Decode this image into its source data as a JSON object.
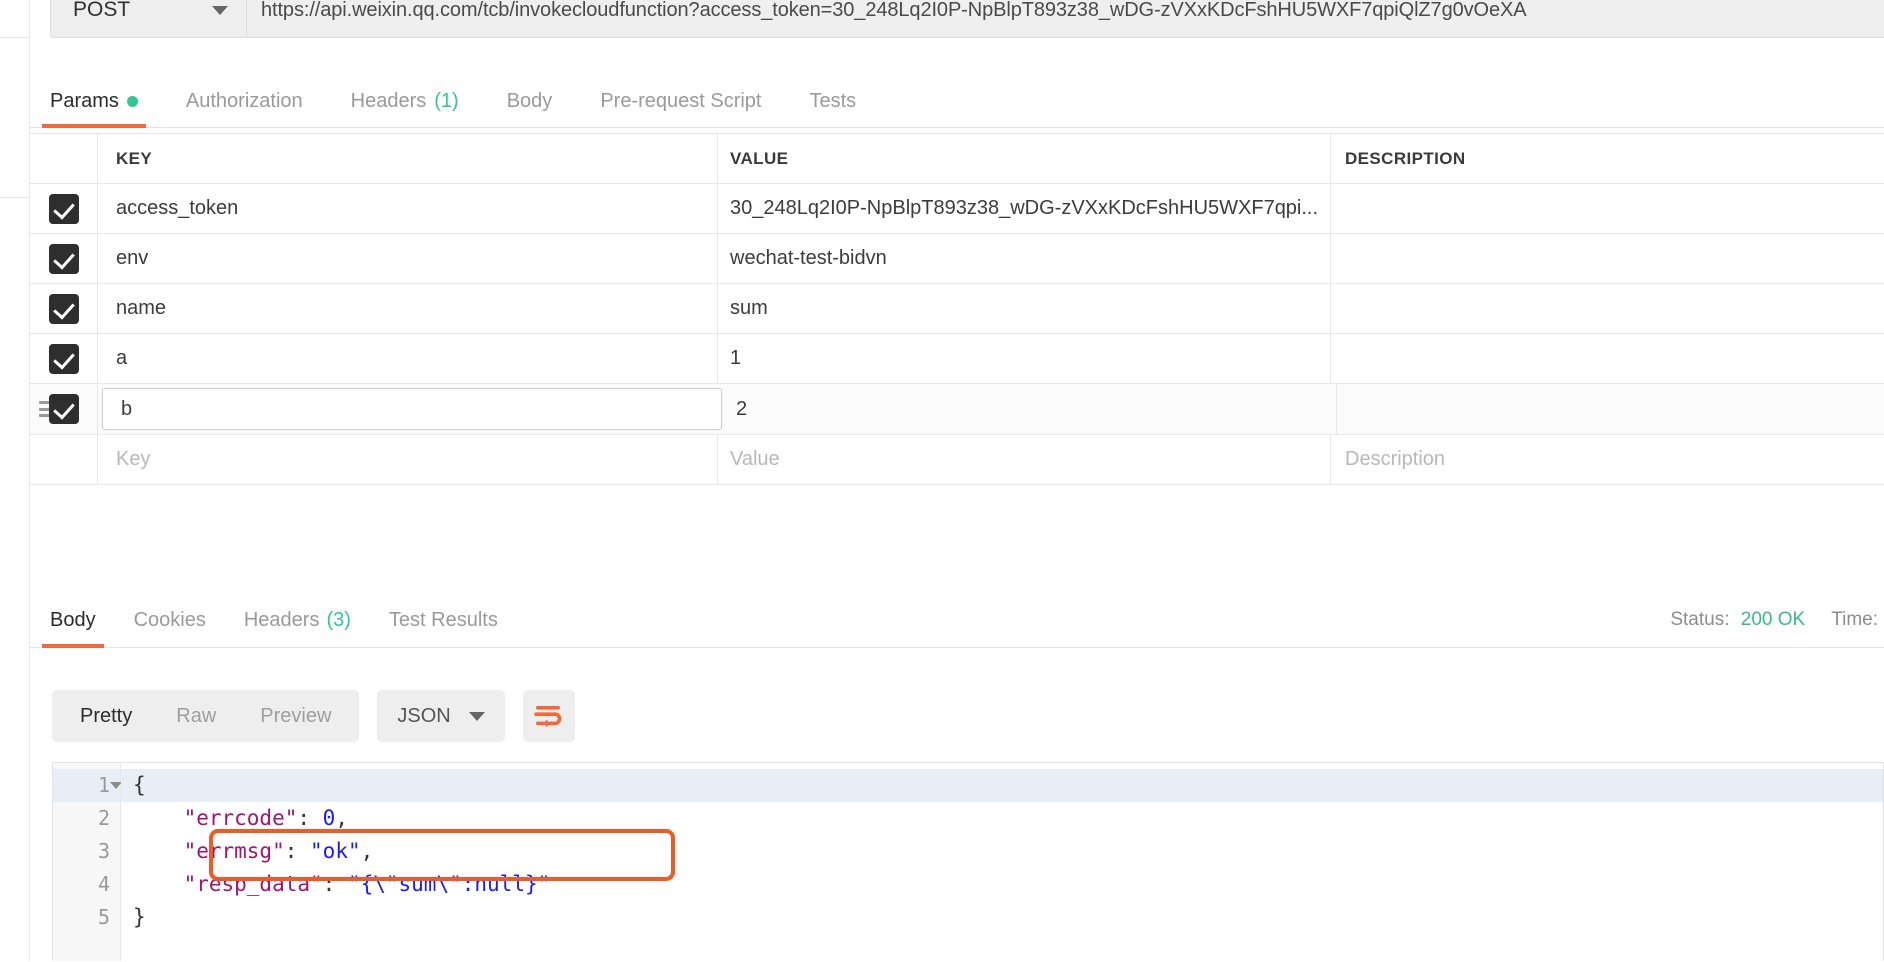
{
  "request": {
    "method": "POST",
    "method_caret_icon": "chevron-down-icon",
    "url": "https://api.weixin.qq.com/tcb/invokecloudfunction?access_token=30_248Lq2I0P-NpBlpT893z38_wDG-zVXxKDcFshHU5WXF7qpiQlZ7g0vOeXA",
    "tabs": [
      {
        "label": "Params",
        "badge": "",
        "dot": true,
        "active": true
      },
      {
        "label": "Authorization",
        "badge": "",
        "dot": false,
        "active": false
      },
      {
        "label": "Headers",
        "badge": "(1)",
        "dot": false,
        "active": false
      },
      {
        "label": "Body",
        "badge": "",
        "dot": false,
        "active": false
      },
      {
        "label": "Pre-request Script",
        "badge": "",
        "dot": false,
        "active": false
      },
      {
        "label": "Tests",
        "badge": "",
        "dot": false,
        "active": false
      }
    ]
  },
  "params_table": {
    "columns": [
      "KEY",
      "VALUE",
      "DESCRIPTION"
    ],
    "rows": [
      {
        "checked": true,
        "key": "access_token",
        "value": "30_248Lq2I0P-NpBlpT893z38_wDG-zVXxKDcFshHU5WXF7qpi...",
        "description": ""
      },
      {
        "checked": true,
        "key": "env",
        "value": "wechat-test-bidvn",
        "description": ""
      },
      {
        "checked": true,
        "key": "name",
        "value": "sum",
        "description": ""
      },
      {
        "checked": true,
        "key": "a",
        "value": "1",
        "description": ""
      },
      {
        "checked": true,
        "key": "b",
        "value": "2",
        "description": "",
        "editing": true,
        "drag_handle": true
      }
    ],
    "placeholder_row": {
      "key": "Key",
      "value": "Value",
      "description": "Description"
    }
  },
  "response": {
    "tabs": [
      {
        "label": "Body",
        "badge": "",
        "active": true
      },
      {
        "label": "Cookies",
        "badge": "",
        "active": false
      },
      {
        "label": "Headers",
        "badge": "(3)",
        "active": false
      },
      {
        "label": "Test Results",
        "badge": "",
        "active": false
      }
    ],
    "status_label": "Status:",
    "status_value": "200 OK",
    "time_label": "Time:",
    "toolbar": {
      "views": [
        {
          "label": "Pretty",
          "active": true
        },
        {
          "label": "Raw",
          "active": false
        },
        {
          "label": "Preview",
          "active": false
        }
      ],
      "format": "JSON",
      "format_caret_icon": "chevron-down-icon",
      "wrap_icon": "wrap-lines-icon"
    },
    "body": {
      "language": "json",
      "line_numbers": [
        "1",
        "2",
        "3",
        "4",
        "5"
      ],
      "lines": [
        {
          "text": "{",
          "segments": [
            {
              "t": "{",
              "c": "punc"
            }
          ]
        },
        {
          "text": "    \"errcode\": 0,",
          "segments": [
            {
              "t": "    ",
              "c": "punc"
            },
            {
              "t": "\"errcode\"",
              "c": "key"
            },
            {
              "t": ": ",
              "c": "punc"
            },
            {
              "t": "0",
              "c": "num"
            },
            {
              "t": ",",
              "c": "punc"
            }
          ]
        },
        {
          "text": "    \"errmsg\": \"ok\",",
          "segments": [
            {
              "t": "    ",
              "c": "punc"
            },
            {
              "t": "\"errmsg\"",
              "c": "key"
            },
            {
              "t": ": ",
              "c": "punc"
            },
            {
              "t": "\"ok\"",
              "c": "str"
            },
            {
              "t": ",",
              "c": "punc"
            }
          ]
        },
        {
          "text": "    \"resp_data\": \"{\\\"sum\\\":null}\"",
          "segments": [
            {
              "t": "    ",
              "c": "punc"
            },
            {
              "t": "\"resp_data\"",
              "c": "key"
            },
            {
              "t": ": ",
              "c": "punc"
            },
            {
              "t": "\"{\\\"sum\\\":null}\"",
              "c": "str"
            }
          ]
        },
        {
          "text": "}",
          "segments": [
            {
              "t": "}",
              "c": "punc"
            }
          ]
        }
      ],
      "highlight_annotation": {
        "target_line": 4,
        "color": "#ef5b25",
        "shape": "rounded-rectangle"
      }
    }
  },
  "colors": {
    "accent_orange": "#f1693c",
    "status_green": "#3bb98a",
    "badge_green": "#2fc98f",
    "annotation_red": "#ef5b25",
    "json_key": "#a3146e",
    "json_value": "#1a1aff"
  }
}
